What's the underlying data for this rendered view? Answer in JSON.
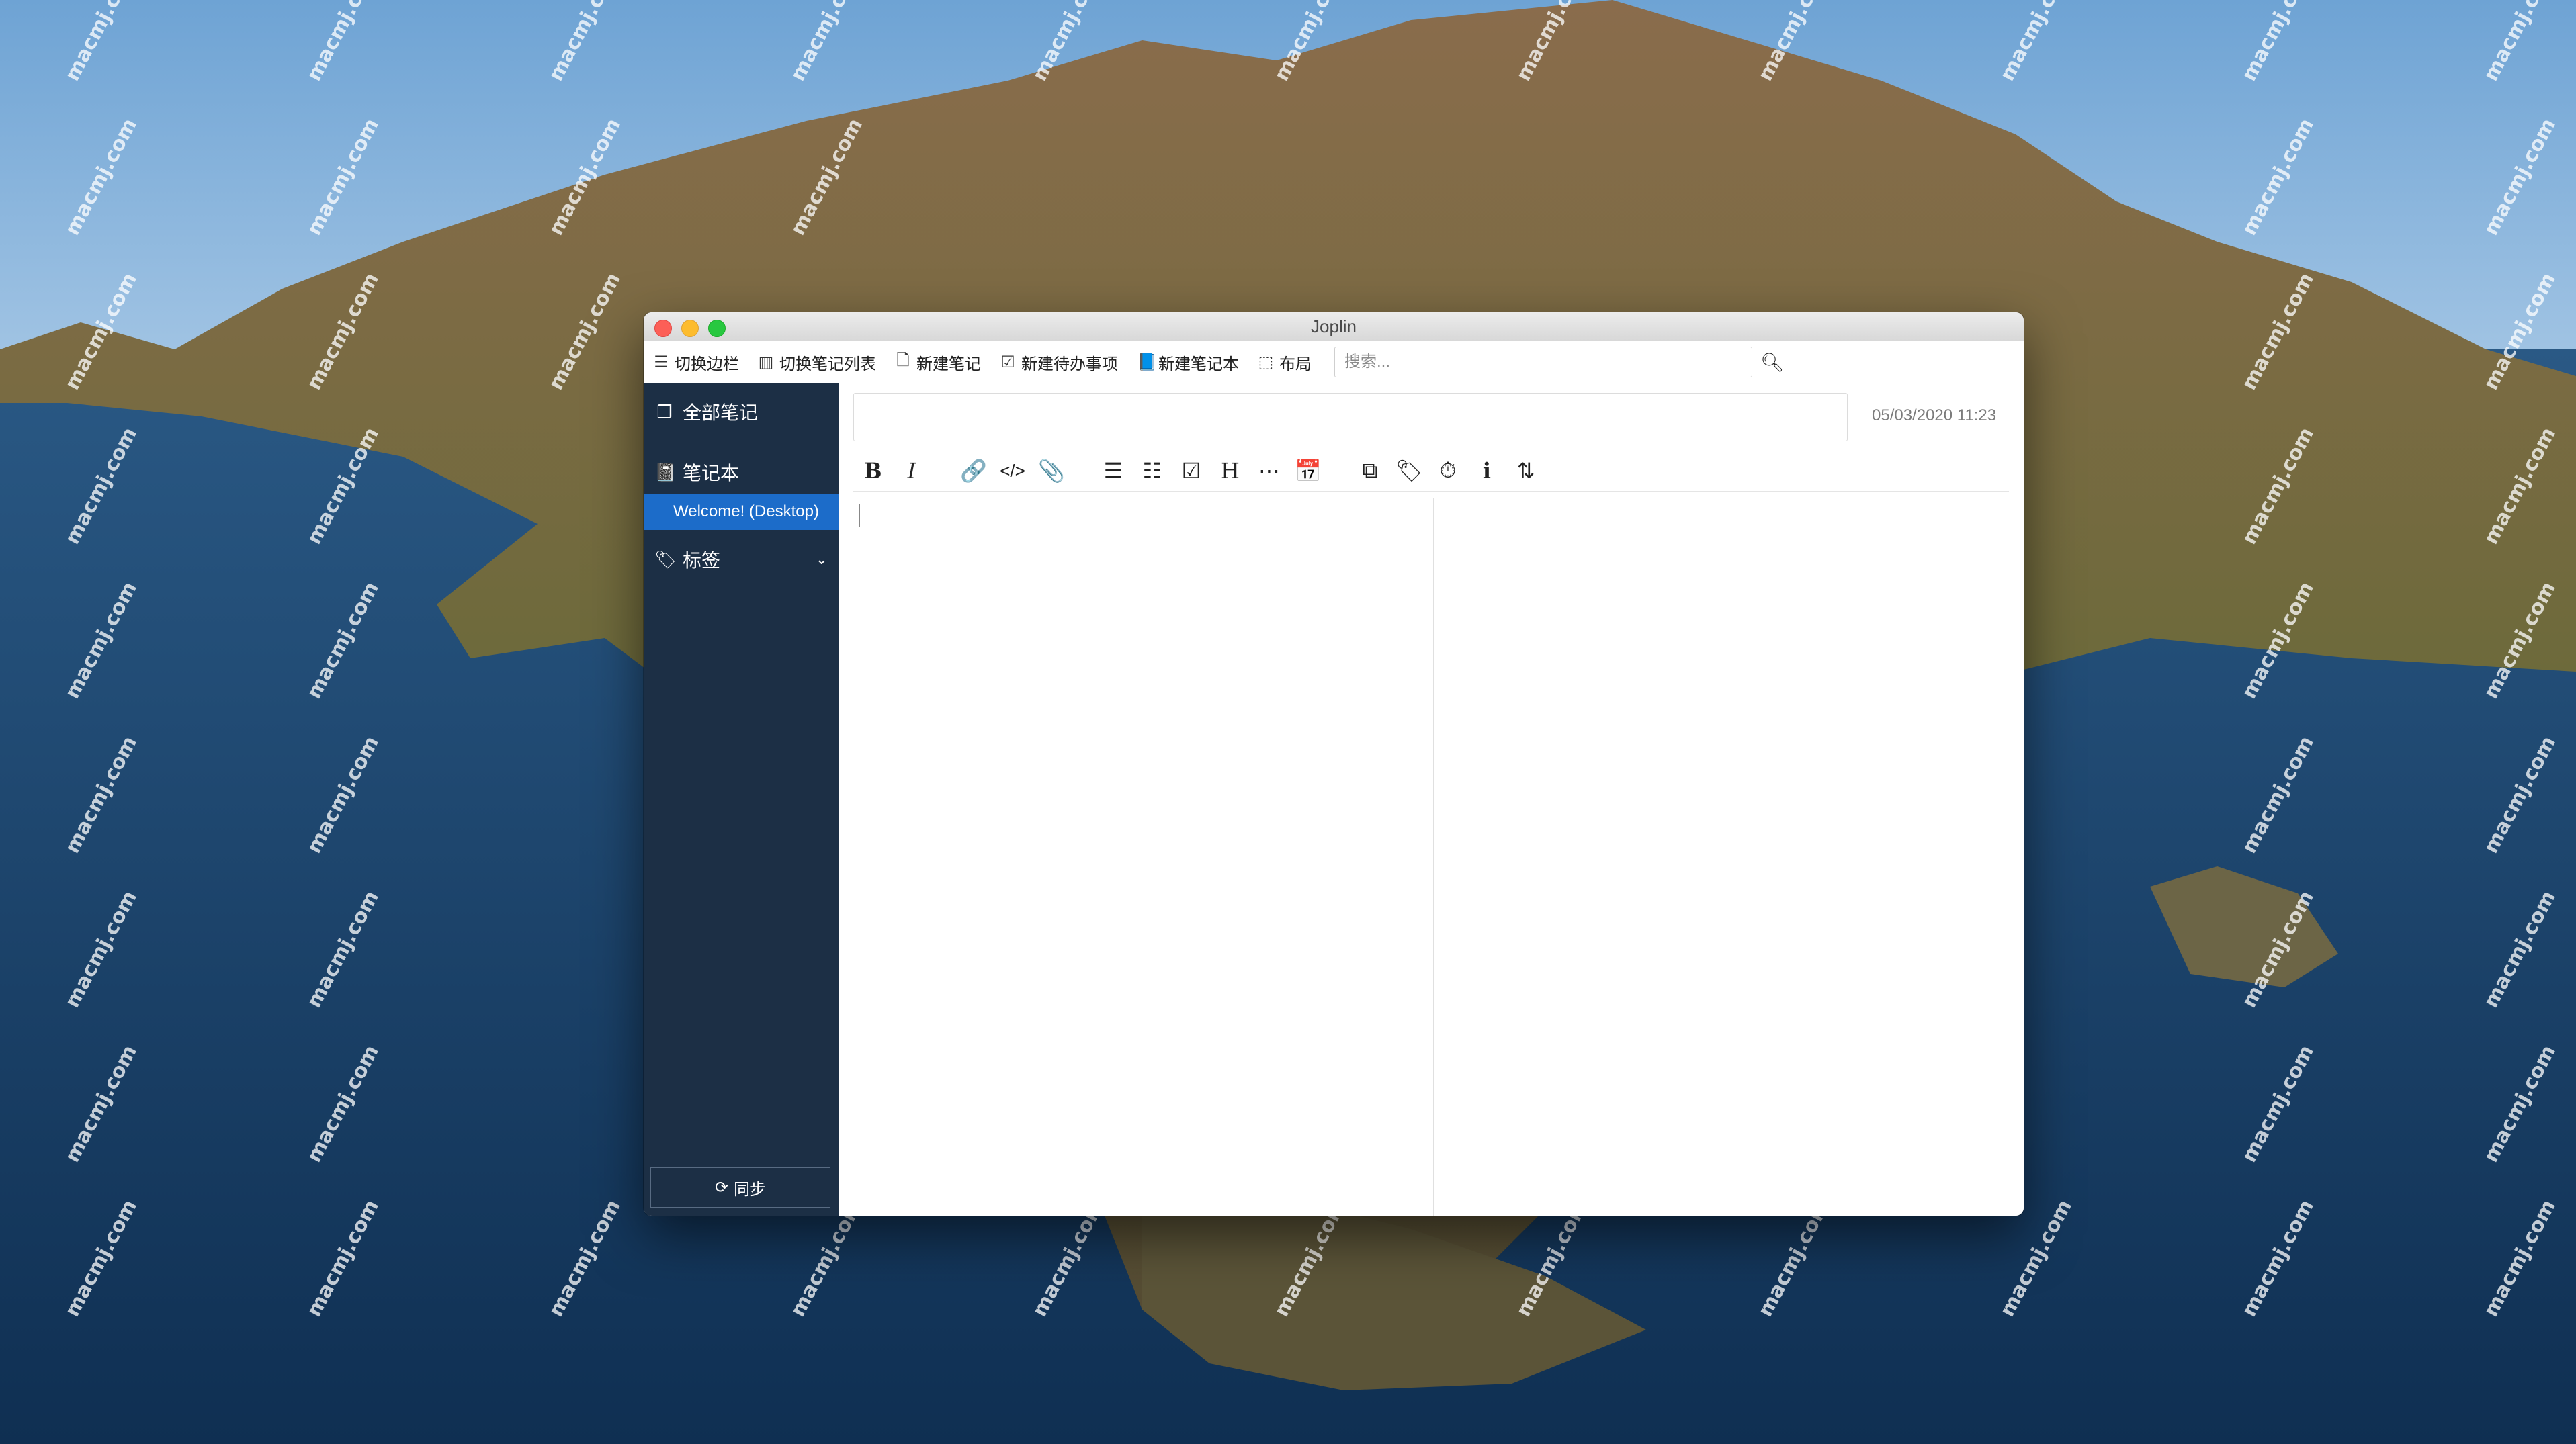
{
  "window": {
    "title": "Joplin"
  },
  "toolbar": {
    "toggle_sidebar": "切换边栏",
    "toggle_note_list": "切换笔记列表",
    "new_note": "新建笔记",
    "new_todo": "新建待办事项",
    "new_notebook": "新建笔记本",
    "layout": "布局",
    "search_placeholder": "搜索..."
  },
  "sidebar": {
    "all_notes": "全部笔记",
    "notebooks": "笔记本",
    "selected_notebook": "Welcome! (Desktop)",
    "tags": "标签",
    "sync": "同步"
  },
  "editor": {
    "title_value": "",
    "date": "05/03/2020 11:23",
    "format_buttons": [
      "bold",
      "italic",
      "link",
      "code",
      "attach",
      "numbered-list",
      "bullet-list",
      "checkbox-list",
      "heading",
      "horizontal-rule",
      "insert-date",
      "external-edit",
      "tags",
      "alarm",
      "info",
      "sort"
    ]
  },
  "watermark_text": "macmj.com",
  "colors": {
    "sidebar_bg": "#1c2f45",
    "selection": "#1c6cc9",
    "close": "#fc5f57",
    "minimize": "#fdbc2e",
    "maximize": "#28c840"
  }
}
